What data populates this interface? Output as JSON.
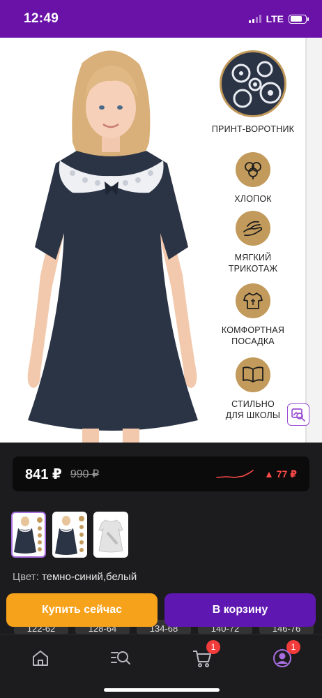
{
  "status_bar": {
    "time": "12:49",
    "network": "LTE",
    "signal_bars": 4,
    "signal_active": 2,
    "battery_level": 0.8
  },
  "product": {
    "features": [
      {
        "icon": "lace-collar-icon",
        "label": "ПРИНТ-ВОРОТНИК"
      },
      {
        "icon": "cotton-icon",
        "label": "ХЛОПОК"
      },
      {
        "icon": "soft-hand-icon",
        "label": "МЯГКИЙ\nТРИКОТАЖ"
      },
      {
        "icon": "tshirt-icon",
        "label": "КОМФОРТНАЯ\nПОСАДКА"
      },
      {
        "icon": "book-icon",
        "label": "СТИЛЬНО\nДЛЯ ШКОЛЫ"
      }
    ],
    "price": {
      "current": "841 ₽",
      "old": "990 ₽",
      "change": "▲ 77 ₽"
    },
    "color": {
      "label": "Цвет:",
      "value": "темно-синий,белый"
    },
    "sizes_peek": [
      "122-62",
      "128-64",
      "134-68",
      "140-72",
      "146-76"
    ]
  },
  "actions": {
    "buy_now": "Купить сейчас",
    "to_cart": "В корзину"
  },
  "bottom_nav": {
    "items": [
      {
        "name": "home",
        "icon": "home-icon"
      },
      {
        "name": "catalog",
        "icon": "catalog-search-icon"
      },
      {
        "name": "cart",
        "icon": "cart-icon",
        "badge": "1"
      },
      {
        "name": "profile",
        "icon": "profile-icon",
        "badge": "1"
      }
    ]
  },
  "colors": {
    "accent": "#5e17b1",
    "status_bar": "#6a11a8",
    "buy": "#f7a21b",
    "gold": "#c29a5b",
    "dress": "#2b3445",
    "badge": "#f23c3c",
    "trend": "#ff4a4a"
  }
}
